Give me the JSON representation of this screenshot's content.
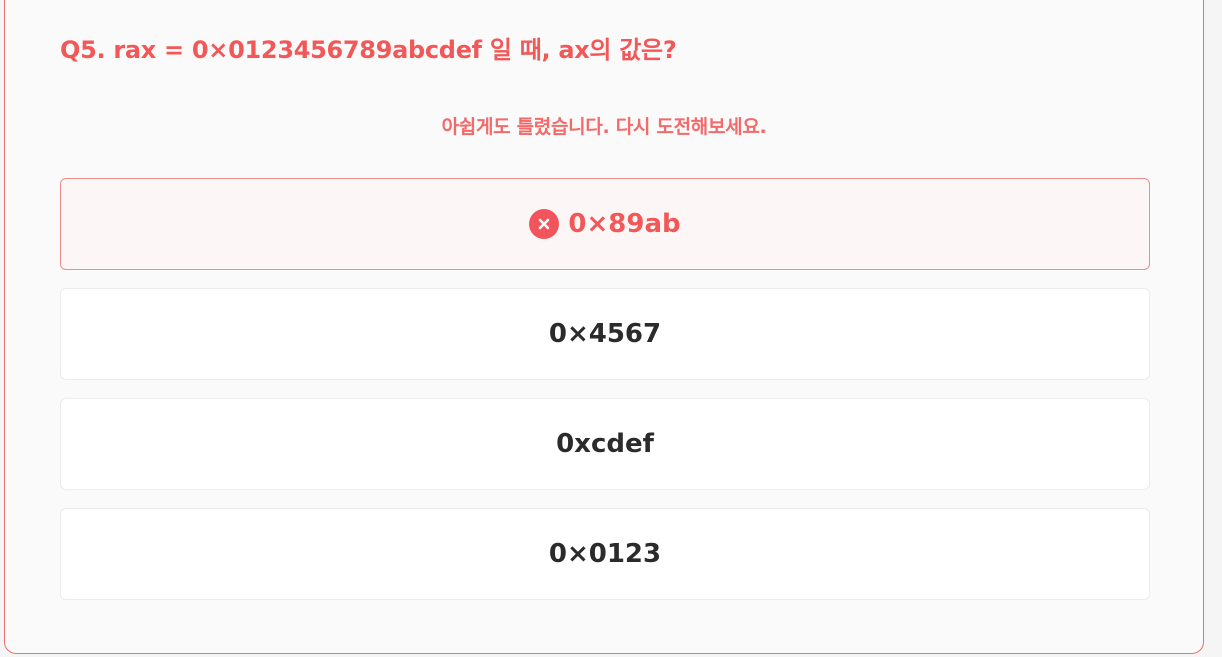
{
  "quiz": {
    "question": "Q5. rax = 0×0123456789abcdef 일 때, ax의 값은?",
    "feedback": "아쉽게도 틀렸습니다. 다시 도전해보세요.",
    "options": [
      {
        "label": "0×89ab",
        "state": "wrong",
        "icon": "x-circle-icon"
      },
      {
        "label": "0×4567",
        "state": "default"
      },
      {
        "label": "0xcdef",
        "state": "default"
      },
      {
        "label": "0×0123",
        "state": "default"
      }
    ]
  },
  "colors": {
    "accent": "#f25858",
    "wrong_background": "#fcf7f6",
    "wrong_border": "#ee8c87",
    "option_border": "#ececec",
    "option_text": "#2b2b2b"
  }
}
